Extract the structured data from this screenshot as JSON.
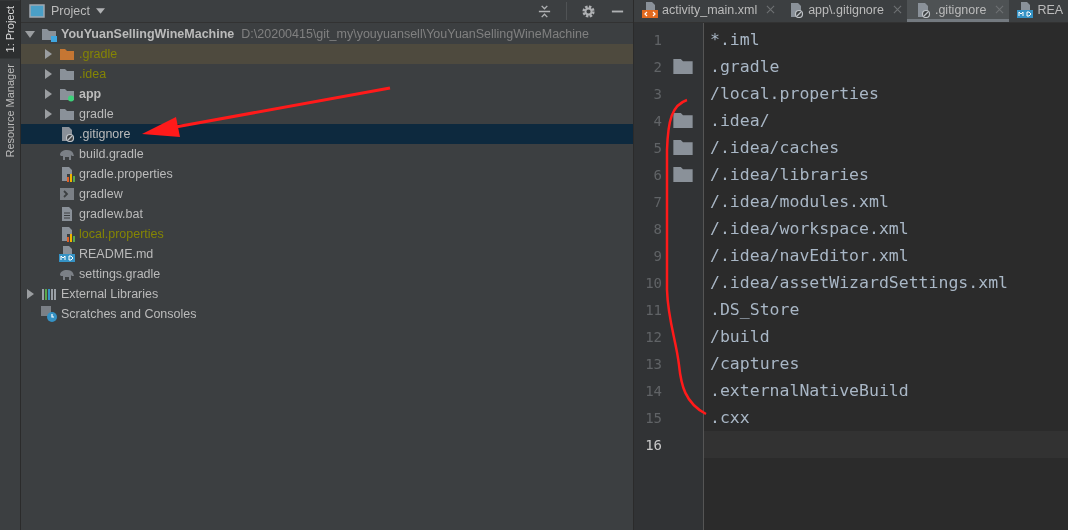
{
  "side_tabs": [
    {
      "label": "1: Project",
      "selected": true
    },
    {
      "label": "Resource Manager",
      "selected": false
    }
  ],
  "project_panel": {
    "title": "Project",
    "tree": [
      {
        "name": "YouYuanSellingWineMachine",
        "path": "D:\\20200415\\git_my\\youyuansell\\YouYuanSellingWineMachine",
        "kind": "module-root",
        "bold": true,
        "ignored": false,
        "expanded": true,
        "selected": false,
        "highlighted": false,
        "children": [
          {
            "name": ".gradle",
            "kind": "folder-excluded",
            "bold": false,
            "ignored": true,
            "expanded": false,
            "selected": false,
            "highlighted": true
          },
          {
            "name": ".idea",
            "kind": "folder",
            "bold": false,
            "ignored": true,
            "expanded": false,
            "selected": false,
            "highlighted": false
          },
          {
            "name": "app",
            "kind": "module",
            "bold": true,
            "ignored": false,
            "expanded": false,
            "selected": false,
            "highlighted": false
          },
          {
            "name": "gradle",
            "kind": "folder",
            "bold": false,
            "ignored": false,
            "expanded": false,
            "selected": false,
            "highlighted": false
          },
          {
            "name": ".gitignore",
            "kind": "ignore-file",
            "bold": false,
            "ignored": false,
            "selected": true,
            "highlighted": false
          },
          {
            "name": "build.gradle",
            "kind": "gradle",
            "bold": false,
            "ignored": false,
            "selected": false,
            "highlighted": false
          },
          {
            "name": "gradle.properties",
            "kind": "properties",
            "bold": false,
            "ignored": false,
            "selected": false,
            "highlighted": false
          },
          {
            "name": "gradlew",
            "kind": "shell",
            "bold": false,
            "ignored": false,
            "selected": false,
            "highlighted": false
          },
          {
            "name": "gradlew.bat",
            "kind": "text",
            "bold": false,
            "ignored": false,
            "selected": false,
            "highlighted": false
          },
          {
            "name": "local.properties",
            "kind": "properties",
            "bold": false,
            "ignored": true,
            "selected": false,
            "highlighted": false
          },
          {
            "name": "README.md",
            "kind": "markdown",
            "bold": false,
            "ignored": false,
            "selected": false,
            "highlighted": false
          },
          {
            "name": "settings.gradle",
            "kind": "gradle",
            "bold": false,
            "ignored": false,
            "selected": false,
            "highlighted": false
          }
        ]
      },
      {
        "name": "External Libraries",
        "kind": "libraries",
        "bold": false,
        "ignored": false,
        "expanded": false,
        "selected": false,
        "highlighted": false
      },
      {
        "name": "Scratches and Consoles",
        "kind": "scratches",
        "bold": false,
        "ignored": false,
        "selected": false,
        "highlighted": false
      }
    ]
  },
  "editor_tabs": [
    {
      "label": "activity_main.xml",
      "kind": "xml",
      "selected": false
    },
    {
      "label": "app\\.gitignore",
      "kind": "ignore-file",
      "selected": false
    },
    {
      "label": ".gitignore",
      "kind": "ignore-file",
      "selected": true
    },
    {
      "label": "REA",
      "kind": "markdown",
      "selected": false
    }
  ],
  "editor": {
    "lines": [
      {
        "number": "1",
        "text": "*.iml",
        "fold_marker": false,
        "current": false
      },
      {
        "number": "2",
        "text": ".gradle",
        "fold_marker": true,
        "current": false
      },
      {
        "number": "3",
        "text": "/local.properties",
        "fold_marker": false,
        "current": false
      },
      {
        "number": "4",
        "text": ".idea/",
        "fold_marker": true,
        "current": false
      },
      {
        "number": "5",
        "text": "/.idea/caches",
        "fold_marker": true,
        "current": false
      },
      {
        "number": "6",
        "text": "/.idea/libraries",
        "fold_marker": true,
        "current": false
      },
      {
        "number": "7",
        "text": "/.idea/modules.xml",
        "fold_marker": false,
        "current": false
      },
      {
        "number": "8",
        "text": "/.idea/workspace.xml",
        "fold_marker": false,
        "current": false
      },
      {
        "number": "9",
        "text": "/.idea/navEditor.xml",
        "fold_marker": false,
        "current": false
      },
      {
        "number": "10",
        "text": "/.idea/assetWizardSettings.xml",
        "fold_marker": false,
        "current": false
      },
      {
        "number": "11",
        "text": ".DS_Store",
        "fold_marker": false,
        "current": false
      },
      {
        "number": "12",
        "text": "/build",
        "fold_marker": false,
        "current": false
      },
      {
        "number": "13",
        "text": "/captures",
        "fold_marker": false,
        "current": false
      },
      {
        "number": "14",
        "text": ".externalNativeBuild",
        "fold_marker": false,
        "current": false
      },
      {
        "number": "15",
        "text": ".cxx",
        "fold_marker": false,
        "current": false
      },
      {
        "number": "16",
        "fold_marker": false,
        "current": true
      }
    ]
  }
}
